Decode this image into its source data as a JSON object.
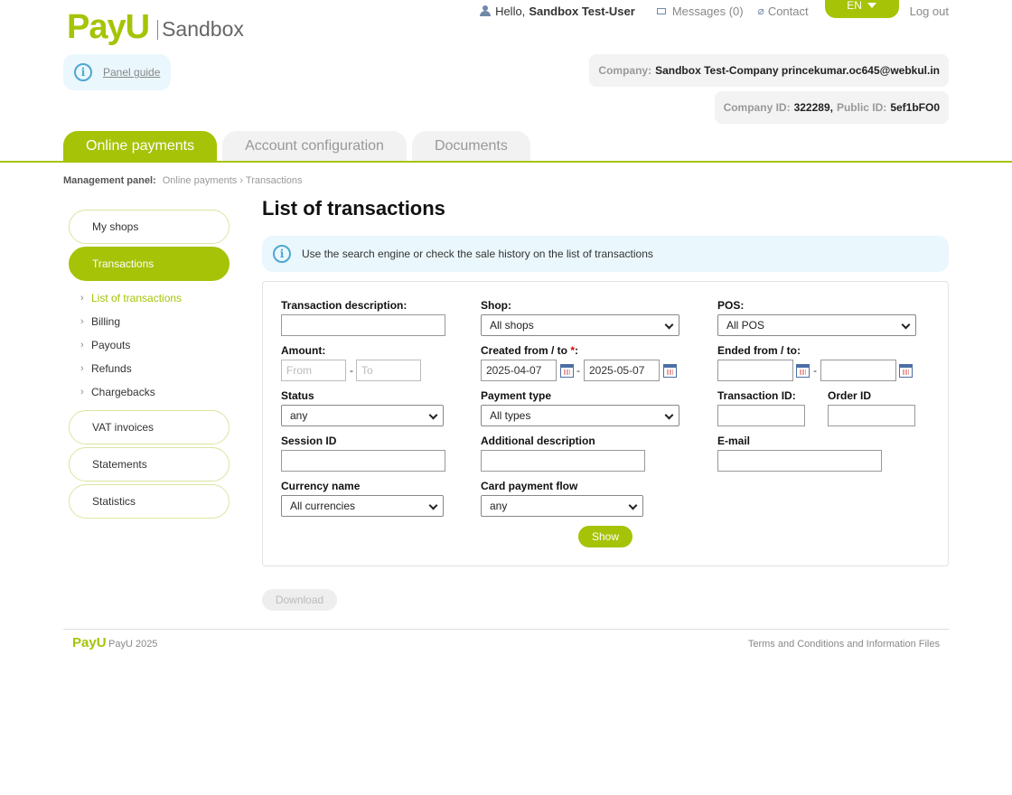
{
  "brand": {
    "logo": "PayU",
    "sandbox": "Sandbox"
  },
  "topbar": {
    "hello_prefix": "Hello,",
    "user_name": "Sandbox Test-User",
    "messages": "Messages (0)",
    "contact": "Contact",
    "lang": "EN",
    "logout": "Log out"
  },
  "panel_guide": "Panel guide",
  "company": {
    "company_label": "Company:",
    "company_value": "Sandbox Test-Company princekumar.oc645@webkul.in",
    "company_id_label": "Company ID:",
    "company_id": "322289,",
    "public_id_label": "Public ID:",
    "public_id": "5ef1bFO0"
  },
  "tabs": [
    "Online payments",
    "Account configuration",
    "Documents"
  ],
  "breadcrumb": {
    "label": "Management panel:",
    "items": [
      "Online payments",
      "›",
      "Transactions"
    ]
  },
  "sidebar": {
    "items": [
      "My shops",
      "Transactions",
      "VAT invoices",
      "Statements",
      "Statistics"
    ],
    "sub": [
      "List of transactions",
      "Billing",
      "Payouts",
      "Refunds",
      "Chargebacks"
    ]
  },
  "main": {
    "title": "List of transactions",
    "notice": "Use the search engine or check the sale history on the list of transactions"
  },
  "form": {
    "transaction_description": "Transaction description:",
    "shop": "Shop:",
    "shop_value": "All shops",
    "pos": "POS:",
    "pos_value": "All POS",
    "amount": "Amount:",
    "amount_from_ph": "From",
    "amount_to_ph": "To",
    "created": "Created from / to",
    "created_req": "*",
    "created_colon": ":",
    "created_from": "2025-04-07",
    "created_to": "2025-05-07",
    "ended": "Ended from / to:",
    "status": "Status",
    "status_value": "any",
    "payment_type": "Payment type",
    "payment_type_value": "All types",
    "transaction_id": "Transaction ID:",
    "order_id": "Order ID",
    "session_id": "Session ID",
    "additional_description": "Additional description",
    "email": "E-mail",
    "currency_name": "Currency name",
    "currency_value": "All currencies",
    "card_flow": "Card payment flow",
    "card_flow_value": "any",
    "dash": "-",
    "show": "Show"
  },
  "download": "Download",
  "footer": {
    "logo": "PayU",
    "copy": "PayU 2025",
    "terms": "Terms and Conditions and Information Files"
  },
  "colors": {
    "accent": "#a6c307",
    "info": "#4da8d1",
    "info_bg": "#eaf7fd"
  }
}
